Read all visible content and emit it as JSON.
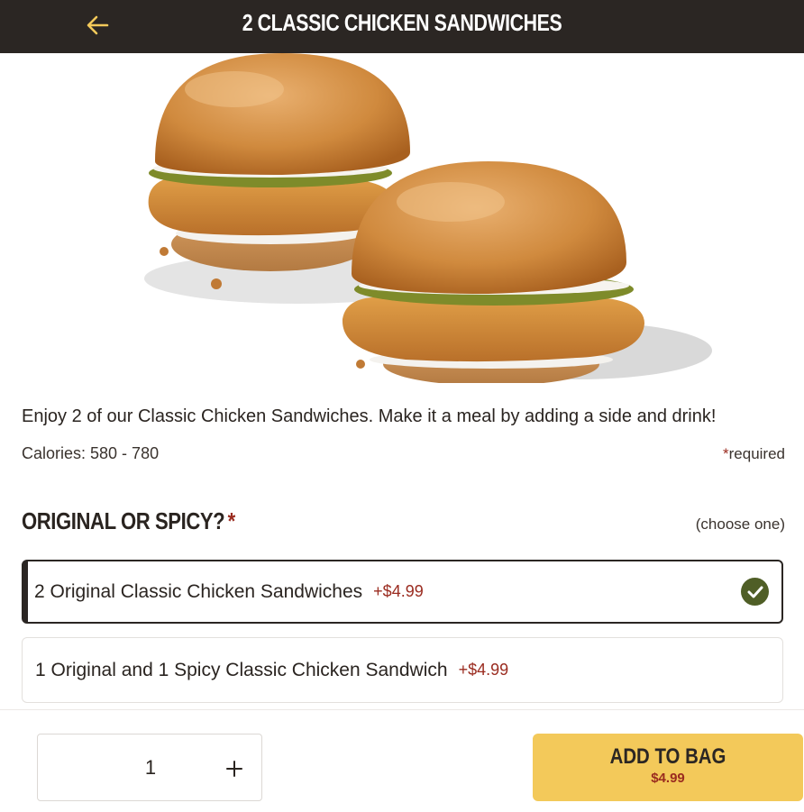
{
  "header": {
    "title": "2 CLASSIC CHICKEN SANDWICHES",
    "back_icon": "arrow-left-icon",
    "accent": "#f3c95a"
  },
  "product": {
    "description": "Enjoy 2 of our Classic Chicken Sandwiches. Make it a meal by adding a side and drink!",
    "calories": "Calories: 580 - 780",
    "required_star": "*",
    "required_note": "required"
  },
  "section": {
    "title": "ORIGINAL OR SPICY?",
    "required_star": "*",
    "hint": "(choose one)",
    "options": [
      {
        "label": "2 Original Classic Chicken Sandwiches",
        "price": "+$4.99",
        "selected": true
      },
      {
        "label": "1 Original and 1 Spicy Classic Chicken Sandwich",
        "price": "+$4.99",
        "selected": false
      }
    ]
  },
  "footer": {
    "quantity": "1",
    "plus_icon": "plus-icon",
    "add_label": "ADD TO BAG",
    "add_price": "$4.99"
  },
  "colors": {
    "topbar": "#2b2623",
    "price_red": "#9a2b1f",
    "check_green": "#4f5e26",
    "button_yellow": "#f3c95a"
  }
}
